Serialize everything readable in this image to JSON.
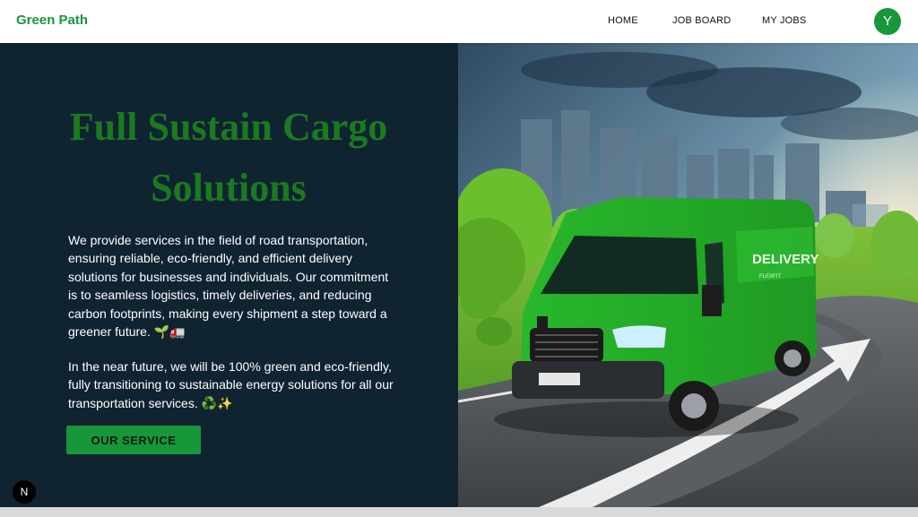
{
  "nav": {
    "brand": "Green Path",
    "links": [
      "HOME",
      "JOB BOARD",
      "MY JOBS"
    ],
    "avatar_initial": "Y"
  },
  "hero": {
    "title": "Full Sustain Cargo Solutions",
    "paragraph1": "We provide services in the field of road transportation, ensuring reliable, eco-friendly, and efficient delivery solutions for businesses and individuals. Our commitment is to seamless logistics, timely deliveries, and reducing carbon footprints, making every shipment a step toward a greener future. 🌱🚛",
    "paragraph2": "In the near future, we will be 100% green and eco-friendly, fully transitioning to sustainable energy solutions for all our transportation services. ♻️✨",
    "cta_label": "OUR SERVICE"
  },
  "image": {
    "van_text": "DELIVERY",
    "van_subtext": "FLEXFIT"
  },
  "dev_badge": "N",
  "colors": {
    "brand_green": "#17963a",
    "title_green": "#1a7a1f",
    "hero_bg": "#102331"
  }
}
